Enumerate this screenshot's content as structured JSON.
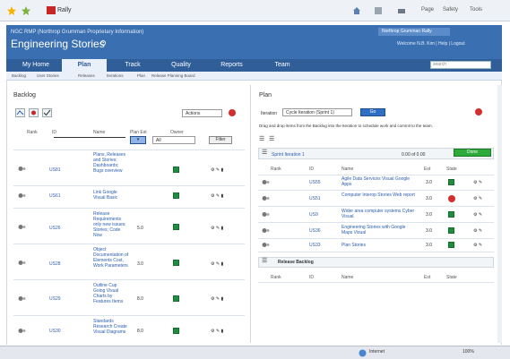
{
  "browser": {
    "tab_title": "Rally",
    "right_items": [
      "Page",
      "Safety",
      "Tools"
    ]
  },
  "header": {
    "breadcrumb": "NGC RMP (Northrop Grumman Proprietary Information)",
    "project_title": "Engineering Stories",
    "user_badge": "Northrop Grumman Rally",
    "welcome": "Welcome N.B. Kim | Help | Logout"
  },
  "nav": {
    "tabs": [
      "My Home",
      "Plan",
      "Track",
      "Quality",
      "Reports",
      "Team"
    ],
    "active": "Plan",
    "search_placeholder": "search"
  },
  "subnav": {
    "items": [
      "Backlog",
      "User Stories",
      "Releases",
      "Iterations",
      "Plan",
      "Release Planning Board"
    ]
  },
  "backlog": {
    "title": "Backlog",
    "actions_label": "Actions",
    "columns": [
      "Rank",
      "ID",
      "Name",
      "Plan Est",
      "Owner"
    ],
    "filter_select": "All",
    "filter_button": "Filter",
    "rows": [
      {
        "id": "US81",
        "name": "Plans, Releases and Stories; Dashboards; Bugs overview",
        "est": "",
        "status": "green"
      },
      {
        "id": "US61",
        "name": "Link Google Visual Basic",
        "est": "",
        "status": "green"
      },
      {
        "id": "US26",
        "name": "Release Requirements only new issues; Stories; Code Now",
        "est": "5.0",
        "status": "green"
      },
      {
        "id": "US28",
        "name": "Object Documentation of Elements Cost, Work Parameters",
        "est": "3.0",
        "status": "green"
      },
      {
        "id": "US29",
        "name": "Outline Cup Going Visual Charts by Features Items",
        "est": "8.0",
        "status": "green"
      },
      {
        "id": "US30",
        "name": "Standards Research Create Visual Diagrams",
        "est": "8.0",
        "status": "green"
      }
    ]
  },
  "plan": {
    "title": "Plan",
    "iteration_label": "Iteration",
    "iteration_value": "Cycle Iteration (Sprint 1)",
    "go_label": "Go",
    "info_text": "Drag and drop items from the Backlog into the Iteration to schedule work and commit to the team.",
    "iteration_name": "Sprint Iteration 1",
    "capacity": "0.00 of 0.00",
    "accept_button": "Done",
    "columns": [
      "Rank",
      "ID",
      "Name",
      "Est",
      "State"
    ],
    "rows": [
      {
        "id": "US55",
        "name": "Agile Data Services Visual Google Apps",
        "est": "3.0",
        "state": "green"
      },
      {
        "id": "US51",
        "name": "Computer Interop Stories Web report",
        "est": "3.0",
        "state": "red"
      },
      {
        "id": "US9",
        "name": "Wider area computer systems Cyber Visual",
        "est": "3.0",
        "state": "green"
      },
      {
        "id": "US36",
        "name": "Engineering Stories with Google Maps Visual",
        "est": "3.0",
        "state": "green"
      },
      {
        "id": "US33",
        "name": "Plan Stories",
        "est": "3.0",
        "state": "green"
      }
    ],
    "release_backlog_title": "Release Backlog",
    "release_columns": [
      "Rank",
      "ID",
      "Name",
      "Est",
      "State"
    ]
  },
  "taskbar": {
    "items": [
      "Internet",
      "100%"
    ]
  }
}
